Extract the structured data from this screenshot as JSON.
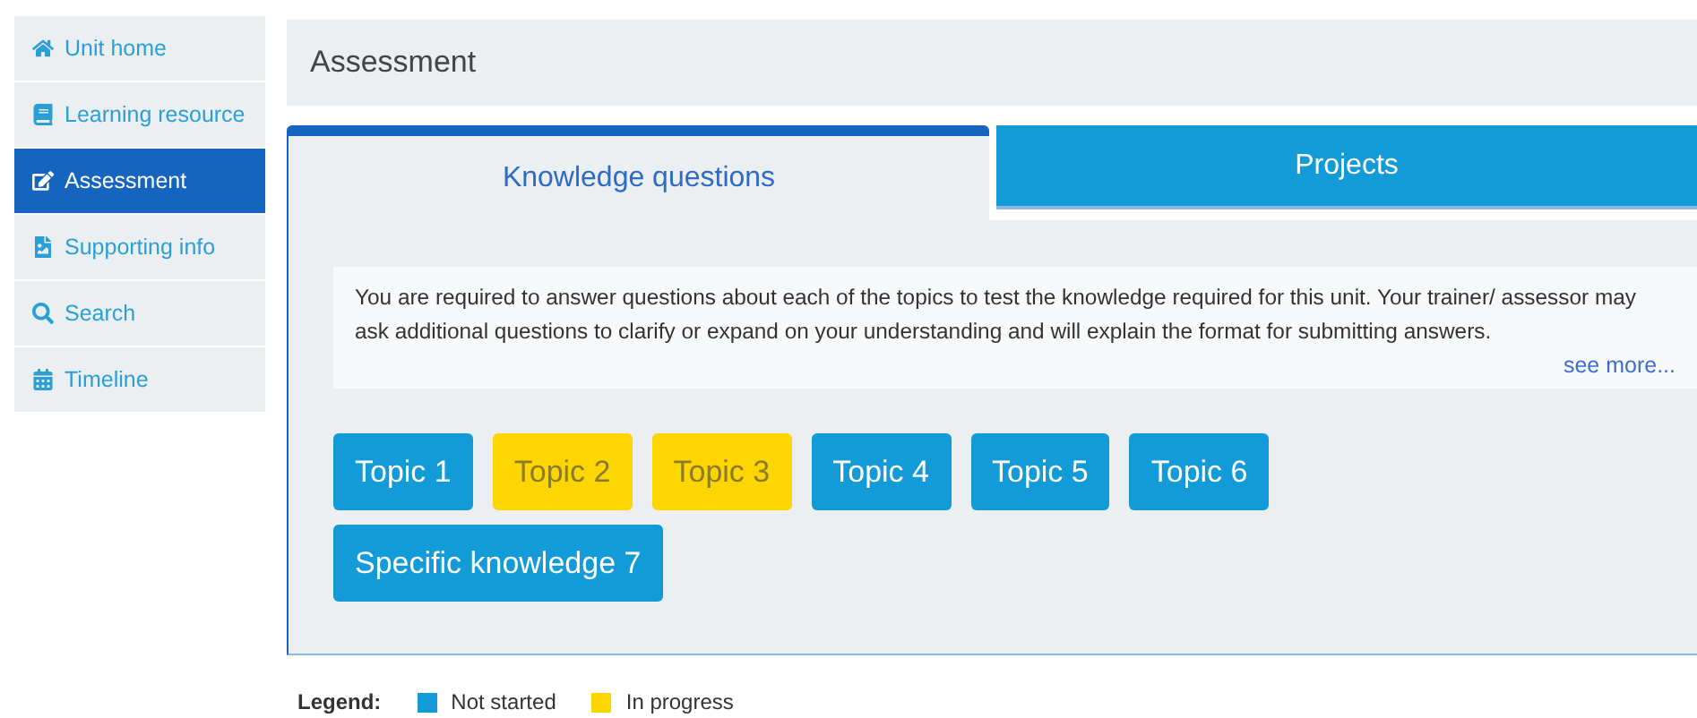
{
  "sidebar": {
    "items": [
      {
        "label": "Unit home",
        "selected": false
      },
      {
        "label": "Learning resource",
        "selected": false
      },
      {
        "label": "Assessment",
        "selected": true
      },
      {
        "label": "Supporting info",
        "selected": false
      },
      {
        "label": "Search",
        "selected": false
      },
      {
        "label": "Timeline",
        "selected": false
      }
    ]
  },
  "header": {
    "title": "Assessment"
  },
  "tabs": [
    {
      "label": "Knowledge questions",
      "selected": true
    },
    {
      "label": "Projects",
      "selected": false
    }
  ],
  "description": {
    "text": "You are required to answer questions about each of the topics to test the knowledge required for this unit. Your trainer/ assessor may ask additional questions to clarify or expand on your understanding and will explain the format for submitting answers.",
    "link": "see more..."
  },
  "topics": [
    {
      "label": "Topic 1",
      "color": "#129bd7"
    },
    {
      "label": "Topic 2",
      "color": "#fdd500"
    },
    {
      "label": "Topic 3",
      "color": "#fdd500"
    },
    {
      "label": "Topic 4",
      "color": "#129bd7"
    },
    {
      "label": "Topic 5",
      "color": "#129bd7"
    },
    {
      "label": "Topic 6",
      "color": "#129bd7"
    },
    {
      "label": "Specific knowledge 7",
      "color": "#129bd7"
    }
  ],
  "legend": {
    "label": "Legend:",
    "items": [
      {
        "label": "Not started",
        "color": "#129bd7"
      },
      {
        "label": "In progress",
        "color": "#fdd500"
      }
    ]
  }
}
